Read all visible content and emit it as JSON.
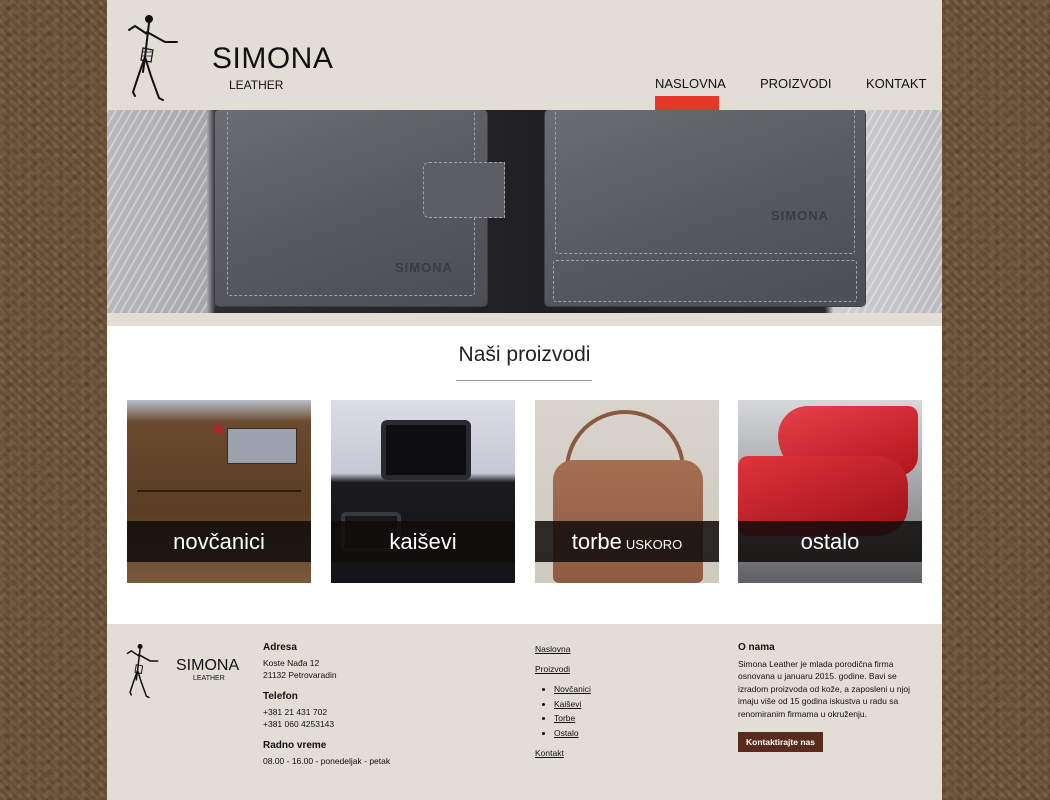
{
  "brand": {
    "title": "SIMONA",
    "subtitle": "LEATHER",
    "wallet_stamp": "SIMONA"
  },
  "nav": {
    "items": [
      "NASLOVNA",
      "PROIZVODI",
      "KONTAKT"
    ],
    "active_index": 0
  },
  "colors": {
    "accent": "#e5382b",
    "header_bg": "#e3ded5",
    "button_bg": "#5a2a1c"
  },
  "products": {
    "title": "Naši proizvodi",
    "items": [
      {
        "label": "novčanici",
        "tag": ""
      },
      {
        "label": "kaiševi",
        "tag": ""
      },
      {
        "label": "torbe",
        "tag": "USKORO"
      },
      {
        "label": "ostalo",
        "tag": ""
      }
    ]
  },
  "footer": {
    "address_heading": "Adresa",
    "address_lines": [
      "Koste Nađa 12",
      "21132 Petrovaradin"
    ],
    "phone_heading": "Telefon",
    "phone_lines": [
      "+381 21 431 702",
      "+381 060 4253143"
    ],
    "hours_heading": "Radno vreme",
    "hours_line": "08.00 - 16.00 - ponedeljak - petak",
    "links": {
      "home": "Naslovna",
      "products": "Proizvodi",
      "sub": [
        "Novčanici",
        "Kaiševi",
        "Torbe",
        "Ostalo"
      ],
      "contact": "Kontakt"
    },
    "about_heading": "O nama",
    "about_text": "Simona Leather je mlada porodična firma osnovana u januaru 2015. godine. Bavi se izradom proizvoda od kože, a zaposleni u njoj imaju više od 15 godina iskustva u radu sa renomiranim firmama u okruženju.",
    "contact_button": "Kontaktirajte nas"
  }
}
